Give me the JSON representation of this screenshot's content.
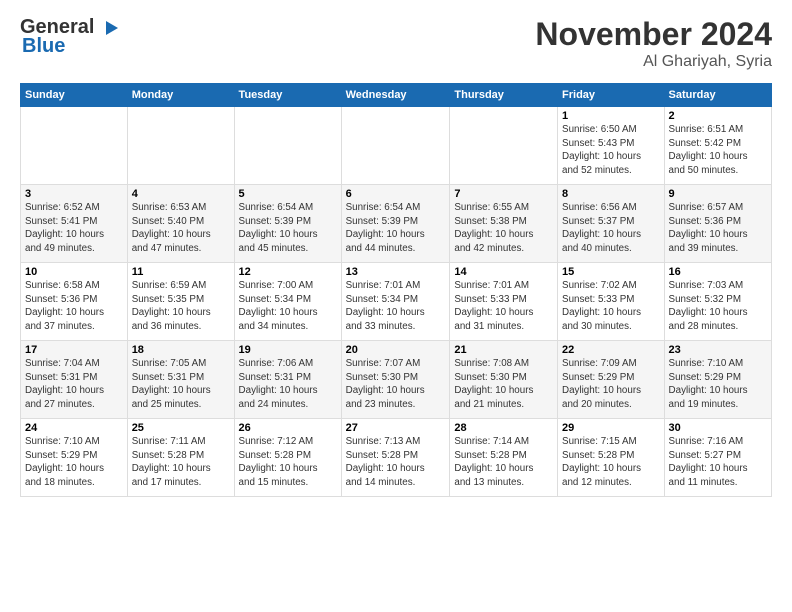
{
  "header": {
    "logo_general": "General",
    "logo_blue": "Blue",
    "month": "November 2024",
    "location": "Al Ghariyah, Syria"
  },
  "weekdays": [
    "Sunday",
    "Monday",
    "Tuesday",
    "Wednesday",
    "Thursday",
    "Friday",
    "Saturday"
  ],
  "weeks": [
    [
      {
        "day": "",
        "info": ""
      },
      {
        "day": "",
        "info": ""
      },
      {
        "day": "",
        "info": ""
      },
      {
        "day": "",
        "info": ""
      },
      {
        "day": "",
        "info": ""
      },
      {
        "day": "1",
        "info": "Sunrise: 6:50 AM\nSunset: 5:43 PM\nDaylight: 10 hours\nand 52 minutes."
      },
      {
        "day": "2",
        "info": "Sunrise: 6:51 AM\nSunset: 5:42 PM\nDaylight: 10 hours\nand 50 minutes."
      }
    ],
    [
      {
        "day": "3",
        "info": "Sunrise: 6:52 AM\nSunset: 5:41 PM\nDaylight: 10 hours\nand 49 minutes."
      },
      {
        "day": "4",
        "info": "Sunrise: 6:53 AM\nSunset: 5:40 PM\nDaylight: 10 hours\nand 47 minutes."
      },
      {
        "day": "5",
        "info": "Sunrise: 6:54 AM\nSunset: 5:39 PM\nDaylight: 10 hours\nand 45 minutes."
      },
      {
        "day": "6",
        "info": "Sunrise: 6:54 AM\nSunset: 5:39 PM\nDaylight: 10 hours\nand 44 minutes."
      },
      {
        "day": "7",
        "info": "Sunrise: 6:55 AM\nSunset: 5:38 PM\nDaylight: 10 hours\nand 42 minutes."
      },
      {
        "day": "8",
        "info": "Sunrise: 6:56 AM\nSunset: 5:37 PM\nDaylight: 10 hours\nand 40 minutes."
      },
      {
        "day": "9",
        "info": "Sunrise: 6:57 AM\nSunset: 5:36 PM\nDaylight: 10 hours\nand 39 minutes."
      }
    ],
    [
      {
        "day": "10",
        "info": "Sunrise: 6:58 AM\nSunset: 5:36 PM\nDaylight: 10 hours\nand 37 minutes."
      },
      {
        "day": "11",
        "info": "Sunrise: 6:59 AM\nSunset: 5:35 PM\nDaylight: 10 hours\nand 36 minutes."
      },
      {
        "day": "12",
        "info": "Sunrise: 7:00 AM\nSunset: 5:34 PM\nDaylight: 10 hours\nand 34 minutes."
      },
      {
        "day": "13",
        "info": "Sunrise: 7:01 AM\nSunset: 5:34 PM\nDaylight: 10 hours\nand 33 minutes."
      },
      {
        "day": "14",
        "info": "Sunrise: 7:01 AM\nSunset: 5:33 PM\nDaylight: 10 hours\nand 31 minutes."
      },
      {
        "day": "15",
        "info": "Sunrise: 7:02 AM\nSunset: 5:33 PM\nDaylight: 10 hours\nand 30 minutes."
      },
      {
        "day": "16",
        "info": "Sunrise: 7:03 AM\nSunset: 5:32 PM\nDaylight: 10 hours\nand 28 minutes."
      }
    ],
    [
      {
        "day": "17",
        "info": "Sunrise: 7:04 AM\nSunset: 5:31 PM\nDaylight: 10 hours\nand 27 minutes."
      },
      {
        "day": "18",
        "info": "Sunrise: 7:05 AM\nSunset: 5:31 PM\nDaylight: 10 hours\nand 25 minutes."
      },
      {
        "day": "19",
        "info": "Sunrise: 7:06 AM\nSunset: 5:31 PM\nDaylight: 10 hours\nand 24 minutes."
      },
      {
        "day": "20",
        "info": "Sunrise: 7:07 AM\nSunset: 5:30 PM\nDaylight: 10 hours\nand 23 minutes."
      },
      {
        "day": "21",
        "info": "Sunrise: 7:08 AM\nSunset: 5:30 PM\nDaylight: 10 hours\nand 21 minutes."
      },
      {
        "day": "22",
        "info": "Sunrise: 7:09 AM\nSunset: 5:29 PM\nDaylight: 10 hours\nand 20 minutes."
      },
      {
        "day": "23",
        "info": "Sunrise: 7:10 AM\nSunset: 5:29 PM\nDaylight: 10 hours\nand 19 minutes."
      }
    ],
    [
      {
        "day": "24",
        "info": "Sunrise: 7:10 AM\nSunset: 5:29 PM\nDaylight: 10 hours\nand 18 minutes."
      },
      {
        "day": "25",
        "info": "Sunrise: 7:11 AM\nSunset: 5:28 PM\nDaylight: 10 hours\nand 17 minutes."
      },
      {
        "day": "26",
        "info": "Sunrise: 7:12 AM\nSunset: 5:28 PM\nDaylight: 10 hours\nand 15 minutes."
      },
      {
        "day": "27",
        "info": "Sunrise: 7:13 AM\nSunset: 5:28 PM\nDaylight: 10 hours\nand 14 minutes."
      },
      {
        "day": "28",
        "info": "Sunrise: 7:14 AM\nSunset: 5:28 PM\nDaylight: 10 hours\nand 13 minutes."
      },
      {
        "day": "29",
        "info": "Sunrise: 7:15 AM\nSunset: 5:28 PM\nDaylight: 10 hours\nand 12 minutes."
      },
      {
        "day": "30",
        "info": "Sunrise: 7:16 AM\nSunset: 5:27 PM\nDaylight: 10 hours\nand 11 minutes."
      }
    ]
  ]
}
